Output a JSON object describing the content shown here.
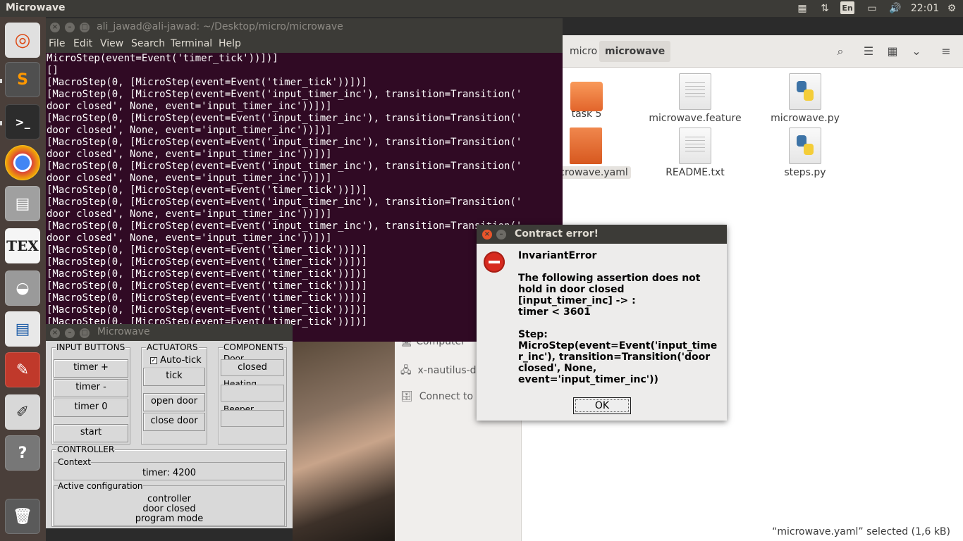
{
  "topbar": {
    "app_title": "Microwave",
    "language": "En",
    "clock": "22:01"
  },
  "launcher": {
    "items": [
      "ubuntu-dash",
      "sublime-text",
      "terminal",
      "chrome",
      "files",
      "texmaker",
      "disks",
      "libreoffice-writer",
      "evince",
      "text-editor",
      "help",
      "trash"
    ]
  },
  "nautilus": {
    "breadcrumbs": [
      "micro",
      "microwave"
    ],
    "files": [
      {
        "name": "task 5",
        "kind": "folder"
      },
      {
        "name": "microwave.feature",
        "kind": "doc"
      },
      {
        "name": "microwave.py",
        "kind": "py"
      },
      {
        "name": "microwave.yaml",
        "display": "crowave.yaml",
        "kind": "yaml",
        "selected": true
      },
      {
        "name": "README.txt",
        "kind": "doc"
      },
      {
        "name": "steps.py",
        "kind": "py"
      }
    ],
    "sidebar": {
      "partial_computer": "Computer",
      "remote": "x-nautilus-d",
      "connect": "Connect to S"
    },
    "status": "“microwave.yaml” selected  (1,6 kB)"
  },
  "terminal": {
    "title": "ali_jawad@ali-jawad: ~/Desktop/micro/microwave",
    "menu": [
      "File",
      "Edit",
      "View",
      "Search",
      "Terminal",
      "Help"
    ],
    "lines": [
      "MicroStep(event=Event('timer_tick'))])]",
      "[]",
      "[MacroStep(0, [MicroStep(event=Event('timer_tick'))])]",
      "[MacroStep(0, [MicroStep(event=Event('input_timer_inc'), transition=Transition('",
      "door closed', None, event='input_timer_inc'))])]",
      "[MacroStep(0, [MicroStep(event=Event('input_timer_inc'), transition=Transition('",
      "door closed', None, event='input_timer_inc'))])]",
      "[MacroStep(0, [MicroStep(event=Event('input_timer_inc'), transition=Transition('",
      "door closed', None, event='input_timer_inc'))])]",
      "[MacroStep(0, [MicroStep(event=Event('input_timer_inc'), transition=Transition('",
      "door closed', None, event='input_timer_inc'))])]",
      "[MacroStep(0, [MicroStep(event=Event('timer_tick'))])]",
      "[MacroStep(0, [MicroStep(event=Event('input_timer_inc'), transition=Transition('",
      "door closed', None, event='input_timer_inc'))])]",
      "[MacroStep(0, [MicroStep(event=Event('input_timer_inc'), transition=Transition('",
      "door closed', None, event='input_timer_inc'))])]",
      "[MacroStep(0, [MicroStep(event=Event('timer_tick'))])]",
      "[MacroStep(0, [MicroStep(event=Event('timer_tick'))])]",
      "[MacroStep(0, [MicroStep(event=Event('timer_tick'))])]",
      "[MacroStep(0, [MicroStep(event=Event('timer_tick'))])]",
      "[MacroStep(0, [MicroStep(event=Event('timer_tick'))])]",
      "[MacroStep(0, [MicroStep(event=Event('timer_tick'))])]",
      "[MacroStep(0, [MicroStep(event=Event('timer_tick'))])]"
    ]
  },
  "microwave": {
    "title": "Microwave",
    "input_buttons": {
      "label": "INPUT BUTTONS",
      "timer_inc": "timer +",
      "timer_dec": "timer -",
      "timer_reset": "timer 0",
      "start": "start"
    },
    "actuators": {
      "label": "ACTUATORS",
      "autotick_label": "Auto-tick",
      "autotick_checked": true,
      "tick": "tick",
      "open_door": "open door",
      "close_door": "close door"
    },
    "components": {
      "label": "COMPONENTS",
      "door_label": "Door",
      "door_value": "closed",
      "heating_label": "Heating",
      "beeper_label": "Beeper"
    },
    "controller": {
      "label": "CONTROLLER",
      "context_label": "Context",
      "context_value": "timer: 4200",
      "active_label": "Active configuration",
      "active_states": [
        "controller",
        "door closed",
        "program mode"
      ]
    }
  },
  "dialog": {
    "title": "Contract error!",
    "heading": "InvariantError",
    "message_lines": [
      "The following assertion does not",
      "hold in door closed",
      "[input_timer_inc] -> :",
      "timer < 3601"
    ],
    "step_lines": [
      "Step:",
      "MicroStep(event=Event('input_time",
      "r_inc'), transition=Transition('door",
      "closed', None,",
      "event='input_timer_inc'))"
    ],
    "ok": "OK"
  },
  "colors": {
    "terminal_bg": "#300a24",
    "panel_bg": "#3c3b37",
    "error_red": "#d72a1f"
  }
}
